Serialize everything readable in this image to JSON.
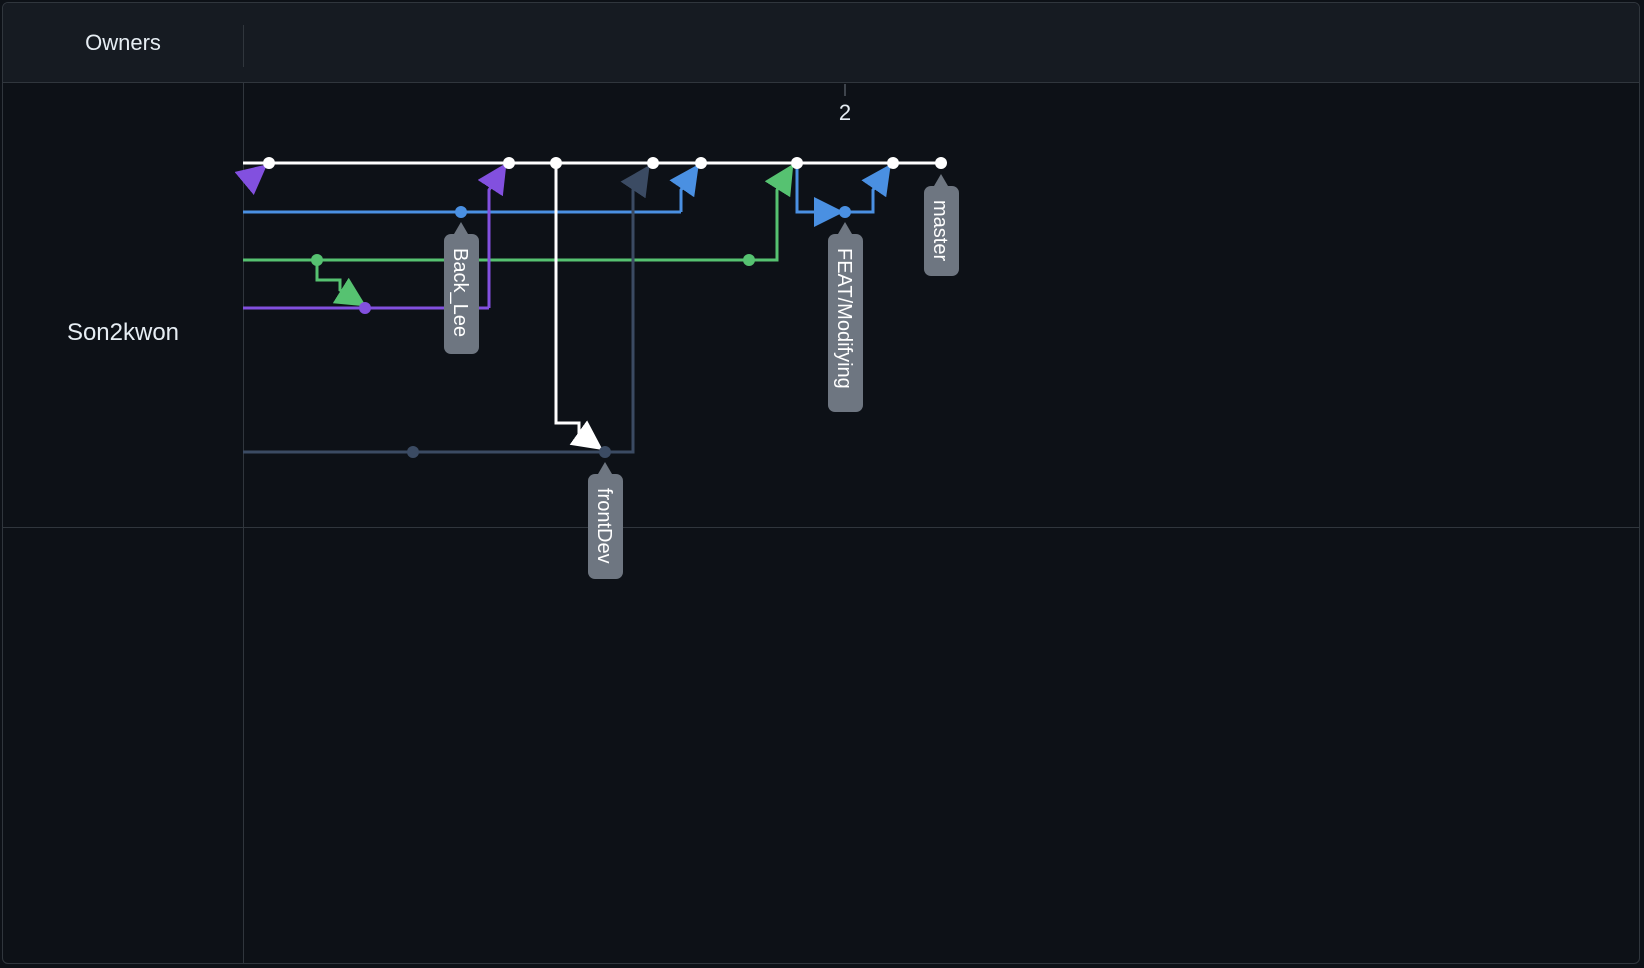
{
  "header": {
    "owners_label": "Owners"
  },
  "timeline": {
    "tick_label": "2"
  },
  "owners": [
    {
      "name": "Son2kwon"
    }
  ],
  "branches": {
    "back_lee": "Back_Lee",
    "feat_modifying": "FEAT/Modifying",
    "master": "master",
    "front_dev": "frontDev"
  },
  "colors": {
    "master": "#ffffff",
    "back_lee": "#4a90e2",
    "feature_green": "#56c271",
    "purple": "#8250df",
    "front_dev": "#3b4b63",
    "label_bg": "#6e7681"
  }
}
